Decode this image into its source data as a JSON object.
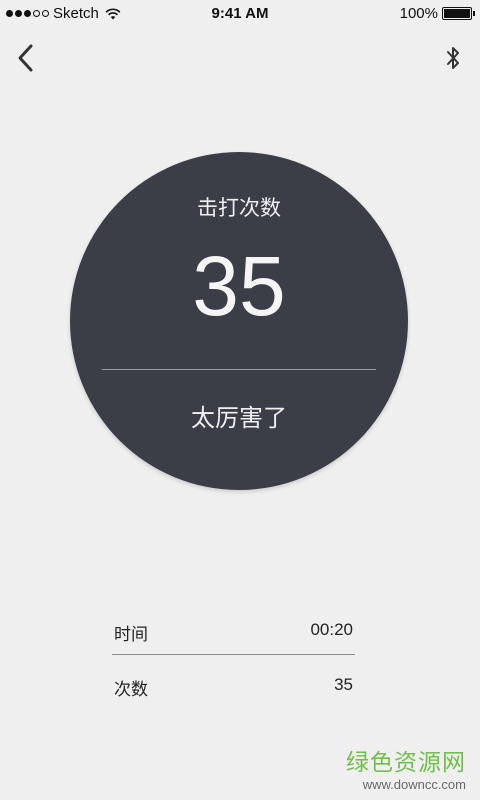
{
  "status_bar": {
    "carrier": "Sketch",
    "time": "9:41 AM",
    "battery": "100%",
    "signal_icon": "signal-dots-icon",
    "wifi_icon": "wifi-icon",
    "battery_icon": "battery-icon"
  },
  "nav": {
    "back_icon": "chevron-left-icon",
    "bluetooth_icon": "bluetooth-icon"
  },
  "hits": {
    "label": "击打次数",
    "count": "35",
    "praise": "太厉害了"
  },
  "stats": [
    {
      "label": "时间",
      "value": "00:20"
    },
    {
      "label": "次数",
      "value": "35"
    }
  ],
  "watermark": {
    "logo": "绿色资源网",
    "url": "www.downcc.com",
    "color": "#6fbf4a"
  },
  "colors": {
    "background": "#efefef",
    "circle": "#3b3d47",
    "circle_text": "#f2f2f2"
  }
}
